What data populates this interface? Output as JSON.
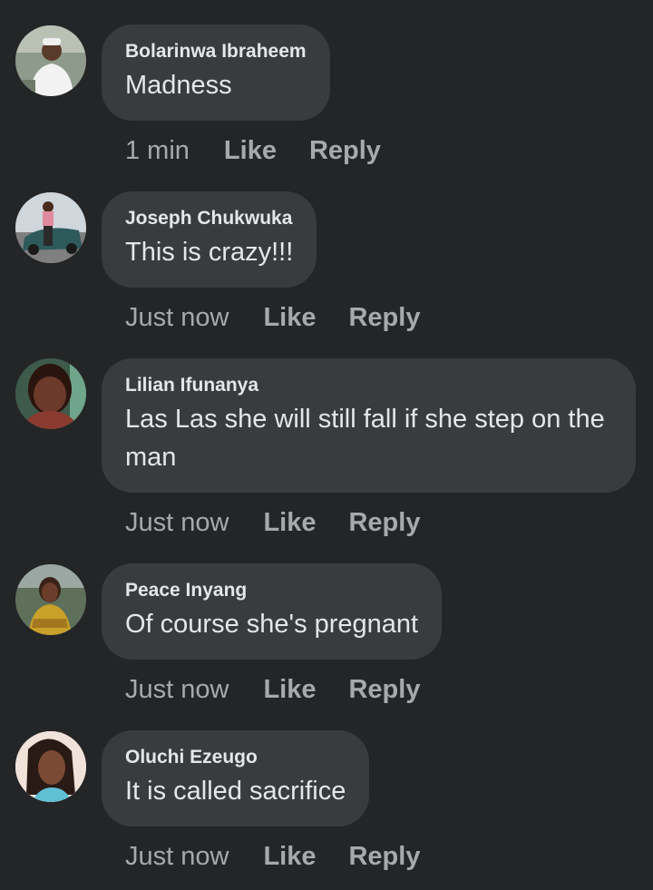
{
  "comments": [
    {
      "author": "Bolarinwa Ibraheem",
      "text": "Madness",
      "time": "1 min",
      "like": "Like",
      "reply": "Reply",
      "avatar": "profile-photo-man-white-cap"
    },
    {
      "author": "Joseph Chukwuka",
      "text": "This is crazy!!!",
      "time": "Just now",
      "like": "Like",
      "reply": "Reply",
      "avatar": "profile-photo-man-with-car"
    },
    {
      "author": "Lilian Ifunanya",
      "text": "Las Las she will still fall if she step on the man",
      "time": "Just now",
      "like": "Like",
      "reply": "Reply",
      "avatar": "profile-photo-woman-selfie"
    },
    {
      "author": "Peace Inyang",
      "text": "Of course she's pregnant",
      "time": "Just now",
      "like": "Like",
      "reply": "Reply",
      "avatar": "profile-photo-woman-yellow-dress"
    },
    {
      "author": "Oluchi Ezeugo",
      "text": "It is called sacrifice",
      "time": "Just now",
      "like": "Like",
      "reply": "Reply",
      "avatar": "profile-photo-woman-braids"
    }
  ],
  "colors": {
    "background": "#242527",
    "bubble": "#3a3b3d",
    "text": "#e4e6eb",
    "meta": "#a7a9ad"
  }
}
